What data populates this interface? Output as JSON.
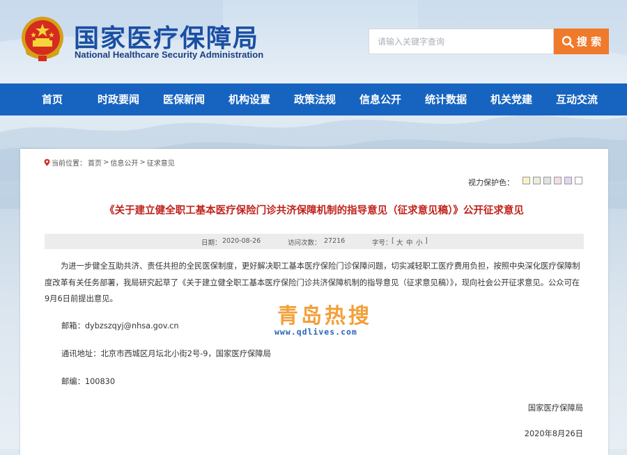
{
  "header": {
    "title_cn": "国家医疗保障局",
    "title_en": "National Healthcare Security Administration",
    "emblem_icon": "national-emblem-icon"
  },
  "search": {
    "placeholder": "请输入关键字查询",
    "button_label": "搜 索",
    "button_icon": "search-icon",
    "button_color": "#f07a2c"
  },
  "nav": {
    "color": "#1664c0",
    "items": [
      {
        "label": "首页"
      },
      {
        "label": "时政要闻"
      },
      {
        "label": "医保新闻"
      },
      {
        "label": "机构设置"
      },
      {
        "label": "政策法规"
      },
      {
        "label": "信息公开"
      },
      {
        "label": "统计数据"
      },
      {
        "label": "机关党建"
      },
      {
        "label": "互动交流"
      }
    ]
  },
  "breadcrumb": {
    "icon": "location-pin-icon",
    "prefix": "当前位置：",
    "items": [
      "首页",
      "信息公开",
      "征求意见"
    ],
    "separator": ">"
  },
  "eye_protection": {
    "label": "视力保护色：",
    "swatches": [
      "#f7f3c9",
      "#e8f0d8",
      "#e2e2e2",
      "#f3dfe3",
      "#e3d6f2",
      "#ffffff"
    ]
  },
  "article": {
    "title": "《关于建立健全职工基本医疗保险门诊共济保障机制的指导意见（征求意见稿）》公开征求意见",
    "title_color": "#c0231c",
    "meta": {
      "date_label": "日期：",
      "date": "2020-08-26",
      "views_label": "访问次数：",
      "views": "27216",
      "fontsize_label": "字号：",
      "fontsize_open": "[",
      "fontsize_large": "大",
      "fontsize_medium": "中",
      "fontsize_small": "小",
      "fontsize_close": "]"
    },
    "paragraph": "为进一步健全互助共济、责任共担的全民医保制度，更好解决职工基本医疗保险门诊保障问题，切实减轻职工医疗费用负担，按照中央深化医疗保障制度改革有关任务部署，我局研究起草了《关于建立健全职工基本医疗保险门诊共济保障机制的指导意见（征求意见稿）》，现向社会公开征求意见。公众可在9月6日前提出意见。",
    "email": "邮箱：dybzszqyj@nhsa.gov.cn",
    "address": "通讯地址：北京市西城区月坛北小街2号-9，国家医疗保障局",
    "postcode": "邮编：100830",
    "signature_org": "国家医疗保障局",
    "signature_date": "2020年8月26日"
  },
  "watermark": {
    "text_cn": "青岛热搜",
    "url": "www.qdlives.com"
  }
}
